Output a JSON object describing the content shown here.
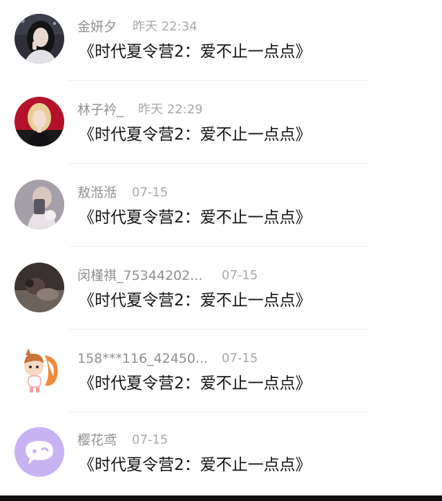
{
  "comments": [
    {
      "username": "金妍夕",
      "time": "昨天 22:34",
      "text": "《时代夏令营2：爱不止一点点》",
      "avatar_icon": "girl-photo-avatar"
    },
    {
      "username": "林子衿_",
      "time": "昨天 22:29",
      "text": "《时代夏令营2：爱不止一点点》",
      "avatar_icon": "blonde-girl-photo-avatar"
    },
    {
      "username": "敖湉湉",
      "time": "07-15",
      "text": "《时代夏令营2：爱不止一点点》",
      "avatar_icon": "mirror-selfie-avatar"
    },
    {
      "username": "闵槿祺_75344202...",
      "time": "07-15",
      "text": "《时代夏令营2：爱不止一点点》",
      "avatar_icon": "dark-photo-avatar"
    },
    {
      "username": "158***116_42450...",
      "time": "07-15",
      "text": "《时代夏令营2：爱不止一点点》",
      "avatar_icon": "cartoon-fox-avatar"
    },
    {
      "username": "樱花鸢",
      "time": "07-15",
      "text": "《时代夏令营2：爱不止一点点》",
      "avatar_icon": "chat-bubble-default-avatar"
    }
  ]
}
